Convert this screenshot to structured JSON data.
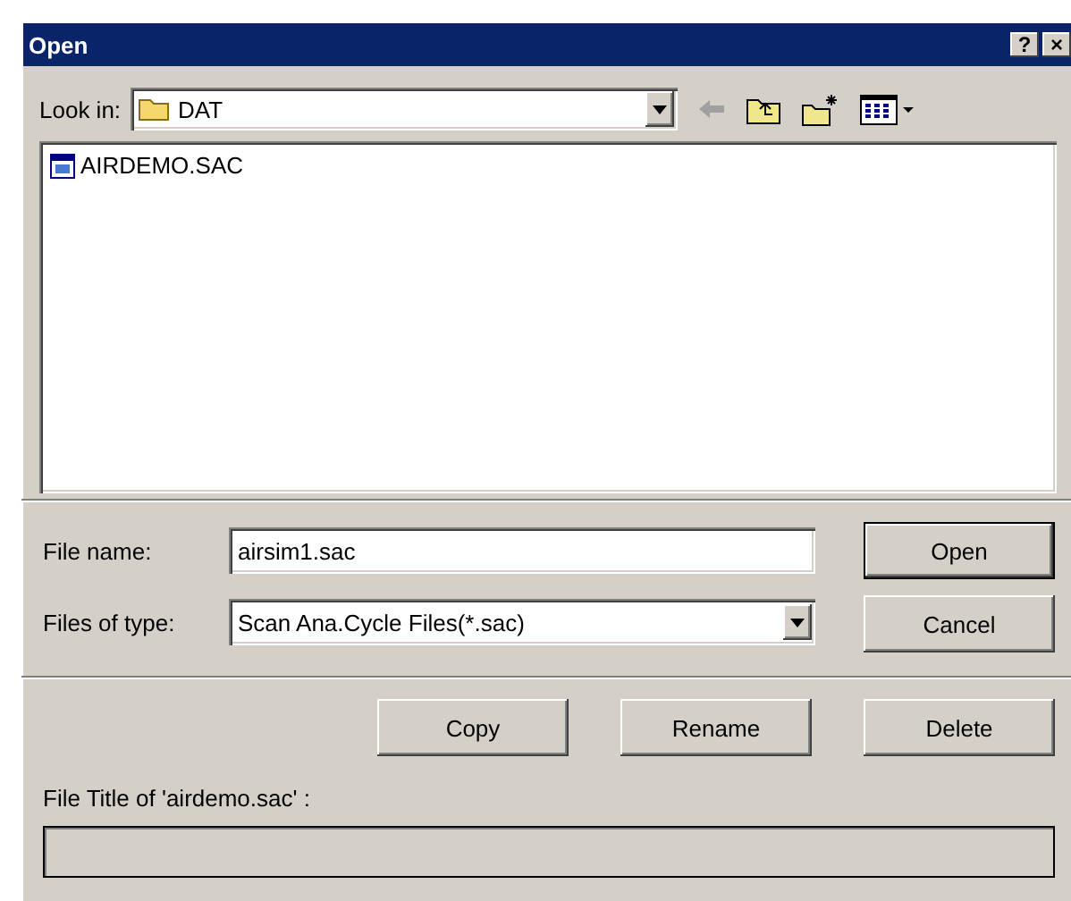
{
  "window": {
    "title": "Open",
    "title_buttons": [
      "?",
      "×"
    ]
  },
  "look_in": {
    "label": "Look in:",
    "value": "DAT"
  },
  "files": [
    {
      "name": "AIRDEMO.SAC",
      "selected": false
    }
  ],
  "file_name": {
    "label": "File name:",
    "value": "airsim1.sac"
  },
  "file_type": {
    "label": "Files of type:",
    "value": "Scan Ana.Cycle Files(*.sac)"
  },
  "buttons": [
    {
      "label": "Open",
      "default": true
    },
    {
      "label": "Cancel",
      "default": false
    }
  ],
  "actions": [
    "Copy",
    "Rename",
    "Delete"
  ],
  "file_title": {
    "label": "File Title of 'airdemo.sac' :"
  }
}
